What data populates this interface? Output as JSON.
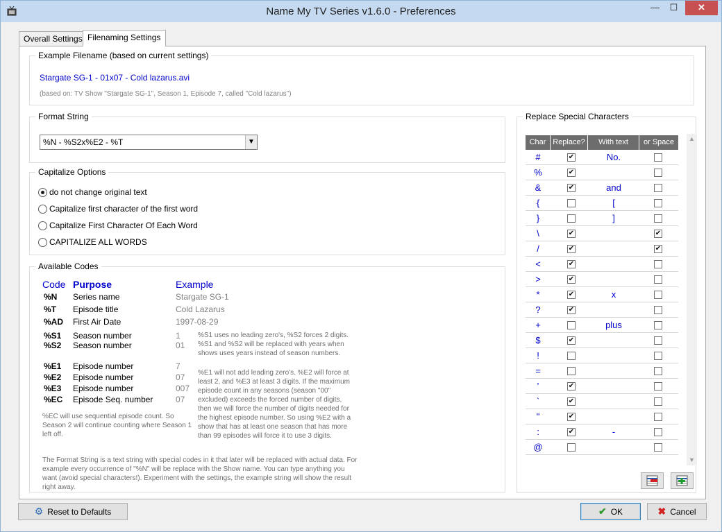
{
  "window": {
    "title": "Name My TV Series v1.6.0 - Preferences",
    "minimize": "—",
    "maximize": "☐",
    "close": "✕"
  },
  "tabs": [
    "Overall Settings",
    "Filenaming Settings"
  ],
  "example": {
    "legend": "Example Filename (based on current settings)",
    "filename": "Stargate SG-1 - 01x07 - Cold lazarus.avi",
    "based_on": "(based on: TV Show \"Stargate SG-1\", Season 1, Episode 7, called \"Cold lazarus\")"
  },
  "format": {
    "legend": "Format String",
    "value": "%N - %S2x%E2 - %T"
  },
  "capitalize": {
    "legend": "Capitalize Options",
    "options": [
      "do not change original text",
      "Capitalize first character of the first word",
      "Capitalize First Character Of Each Word",
      "CAPITALIZE ALL WORDS"
    ],
    "selected_index": 0
  },
  "codes": {
    "legend": "Available Codes",
    "header": {
      "code": "Code",
      "purpose": "Purpose",
      "example": "Example"
    },
    "rows": [
      {
        "code": "%N",
        "purpose": "Series name",
        "example": "Stargate SG-1"
      },
      {
        "code": "%T",
        "purpose": "Episode title",
        "example": "Cold Lazarus"
      },
      {
        "code": "%AD",
        "purpose": "First Air Date",
        "example": "1997-08-29"
      },
      {
        "code": "%S1",
        "purpose": "Season number",
        "example": "1"
      },
      {
        "code": "%S2",
        "purpose": "Season number",
        "example": "01"
      },
      {
        "code": "%E1",
        "purpose": "Episode number",
        "example": "7"
      },
      {
        "code": "%E2",
        "purpose": "Episode number",
        "example": "07"
      },
      {
        "code": "%E3",
        "purpose": "Episode number",
        "example": "007"
      },
      {
        "code": "%EC",
        "purpose": "Episode Seq. number",
        "example": "07"
      }
    ],
    "note_season": "%S1 uses no leading zero's, %S2 forces 2 digits. %S1 and %S2 will be replaced with years when shows uses years instead of season numbers.",
    "note_episode": "%E1 will not add leading zero's. %E2 will force at least 2, and %E3 at least 3 digits.  If the maximum episode count in any seasons (season \"00\" excluded) exceeds the forced number of digits,  then we will force the number of digits needed for the highest episode number.  So using %E2 with a show that has at least one season that has more than 99 episodes will force it to use 3 digits.",
    "note_ec": "%EC will use sequential episode count. So Season 2 will continue counting where Season 1 left off.",
    "note_format": "The Format String is a text string with special codes in it that later will be replaced with actual data.  For example every occurrence of \"%N\" will be replace with the Show name. You can type anything you want (avoid special characters!).  Experiment with the settings, the example string will show the result right away."
  },
  "replace": {
    "legend": "Replace Special Characters",
    "columns": [
      "Char",
      "Replace?",
      "With text",
      "or Space"
    ],
    "rows": [
      {
        "char": "#",
        "replace": true,
        "with": "No.",
        "space": false
      },
      {
        "char": "%",
        "replace": true,
        "with": "",
        "space": false
      },
      {
        "char": "&",
        "replace": true,
        "with": "and",
        "space": false
      },
      {
        "char": "{",
        "replace": false,
        "with": "[",
        "space": false
      },
      {
        "char": "}",
        "replace": false,
        "with": "]",
        "space": false
      },
      {
        "char": "\\",
        "replace": true,
        "with": "",
        "space": true
      },
      {
        "char": "/",
        "replace": true,
        "with": "",
        "space": true
      },
      {
        "char": "<",
        "replace": true,
        "with": "",
        "space": false
      },
      {
        "char": ">",
        "replace": true,
        "with": "",
        "space": false
      },
      {
        "char": "*",
        "replace": true,
        "with": "x",
        "space": false
      },
      {
        "char": "?",
        "replace": true,
        "with": "",
        "space": false
      },
      {
        "char": "+",
        "replace": false,
        "with": "plus",
        "space": false
      },
      {
        "char": "$",
        "replace": true,
        "with": "",
        "space": false
      },
      {
        "char": "!",
        "replace": false,
        "with": "",
        "space": false
      },
      {
        "char": "=",
        "replace": false,
        "with": "",
        "space": false
      },
      {
        "char": "'",
        "replace": true,
        "with": "",
        "space": false
      },
      {
        "char": "`",
        "replace": true,
        "with": "",
        "space": false
      },
      {
        "char": "\"",
        "replace": true,
        "with": "",
        "space": false
      },
      {
        "char": ":",
        "replace": true,
        "with": "-",
        "space": false
      },
      {
        "char": "@",
        "replace": false,
        "with": "",
        "space": false
      }
    ]
  },
  "buttons": {
    "reset": "Reset to Defaults",
    "ok": "OK",
    "cancel": "Cancel"
  }
}
